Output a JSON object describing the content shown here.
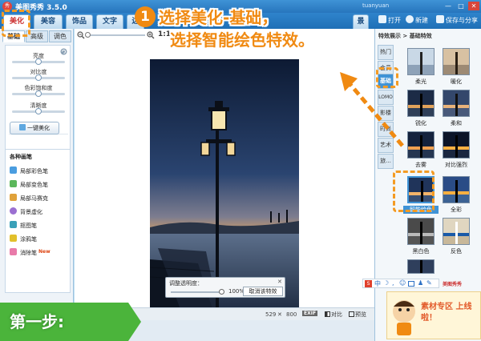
{
  "window": {
    "logo_text": "秀",
    "title": "美图秀秀 3.5.0",
    "account": "tuanyuan",
    "min": "—",
    "max": "□",
    "close": "✕"
  },
  "tabs": [
    {
      "label": "美化",
      "active": true
    },
    {
      "label": "美容"
    },
    {
      "label": "饰品"
    },
    {
      "label": "文字"
    },
    {
      "label": "边"
    },
    {
      "label": "景"
    }
  ],
  "toolbar": {
    "open": "打开",
    "new": "新建",
    "save_share": "保存与分享"
  },
  "left_panel": {
    "subtabs": [
      "基础",
      "高级",
      "调色"
    ],
    "sliders": [
      {
        "label": "亮度",
        "value": 0.5
      },
      {
        "label": "对比度",
        "value": 0.5
      },
      {
        "label": "色彩饱和度",
        "value": 0.5
      },
      {
        "label": "清晰度",
        "value": 0.5
      }
    ],
    "onekey_label": "一键美化",
    "brush_title": "各种画笔",
    "brushes": [
      {
        "label": "局部彩色笔",
        "color": "#4a9de0"
      },
      {
        "label": "局部变色笔",
        "color": "#5bb75b"
      },
      {
        "label": "局部马赛克",
        "color": "#e0a23a"
      },
      {
        "label": "背景虚化",
        "color": "#9b6fd1"
      },
      {
        "label": "抠图笔",
        "color": "#3aa0b8"
      },
      {
        "label": "涂鸦笔",
        "color": "#e2c02b"
      },
      {
        "label": "消除笔",
        "color": "#e87aa9",
        "new": "New"
      }
    ]
  },
  "zoom": {
    "label": "1:1"
  },
  "opacity_panel": {
    "title": "调整透明度：",
    "value": "100%",
    "value_fraction": 1.0,
    "cancel": "取消该特效",
    "close": "✕"
  },
  "status": {
    "width": "529",
    "times": "✕",
    "height": "800",
    "exif": "EXIF",
    "compare": "对比",
    "preview": "预览"
  },
  "right_panel": {
    "breadcrumb": "特效展示 > 基础特效",
    "categories": [
      "热门",
      "会员",
      "基础",
      "LOMO",
      "影楼",
      "时尚",
      "艺术",
      "旅..."
    ],
    "active_category": "基础",
    "effects": [
      {
        "label": "柔光"
      },
      {
        "label": "暖化"
      },
      {
        "label": "锐化"
      },
      {
        "label": "柔和"
      },
      {
        "label": "去雾"
      },
      {
        "label": "对比强烈"
      },
      {
        "label": "智能绘色",
        "selected": true
      },
      {
        "label": "全彩"
      },
      {
        "label": "黑白色"
      },
      {
        "label": "反色"
      }
    ],
    "promo_text": "素材专区 上线啦！",
    "promo_brand": "美图秀秀"
  },
  "annotation": {
    "step_number": "1",
    "line1": "选择美化-基础，",
    "line2": "选择智能绘色特效。",
    "banner": "第一步:"
  }
}
